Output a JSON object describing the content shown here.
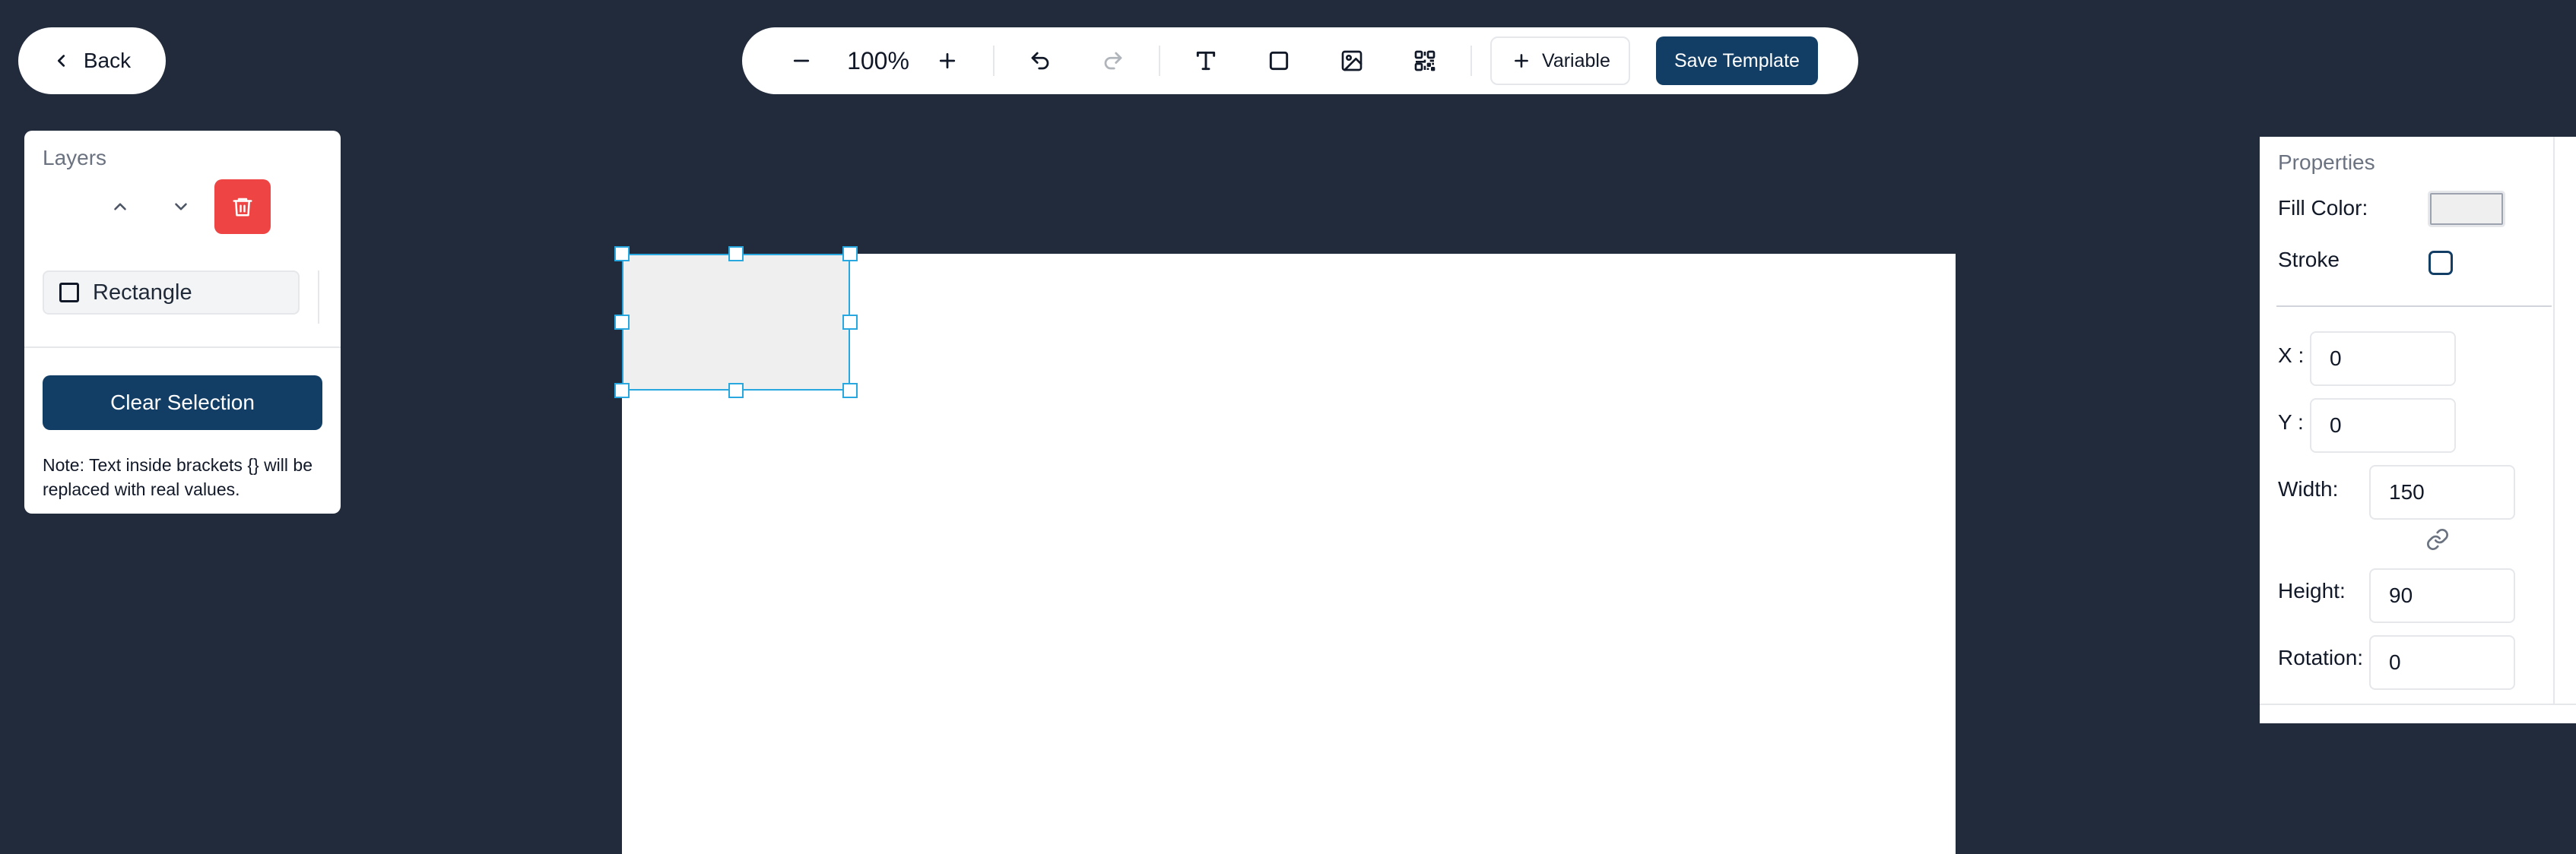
{
  "back": {
    "label": "Back"
  },
  "toolbar": {
    "zoom_level": "100%",
    "variable_label": "Variable",
    "save_label": "Save Template",
    "icons": [
      "minus-icon",
      "plus-icon",
      "undo-icon",
      "redo-icon",
      "text-icon",
      "rectangle-icon",
      "image-icon",
      "qr-code-icon"
    ]
  },
  "layers": {
    "title": "Layers",
    "items": [
      {
        "label": "Rectangle"
      }
    ],
    "clear_label": "Clear Selection",
    "note": "Note: Text inside brackets {} will be replaced with real values."
  },
  "properties": {
    "title": "Properties",
    "fill_label": "Fill Color:",
    "fill_color": "#efefef",
    "stroke_label": "Stroke",
    "x_label": "X :",
    "x_value": "0",
    "y_label": "Y :",
    "y_value": "0",
    "width_label": "Width:",
    "width_value": "150",
    "height_label": "Height:",
    "height_value": "90",
    "rotation_label": "Rotation:",
    "rotation_value": "0"
  },
  "colors": {
    "background": "#212b3b",
    "primary": "#123e66",
    "danger": "#ef4444",
    "selection": "#29a8e0"
  }
}
